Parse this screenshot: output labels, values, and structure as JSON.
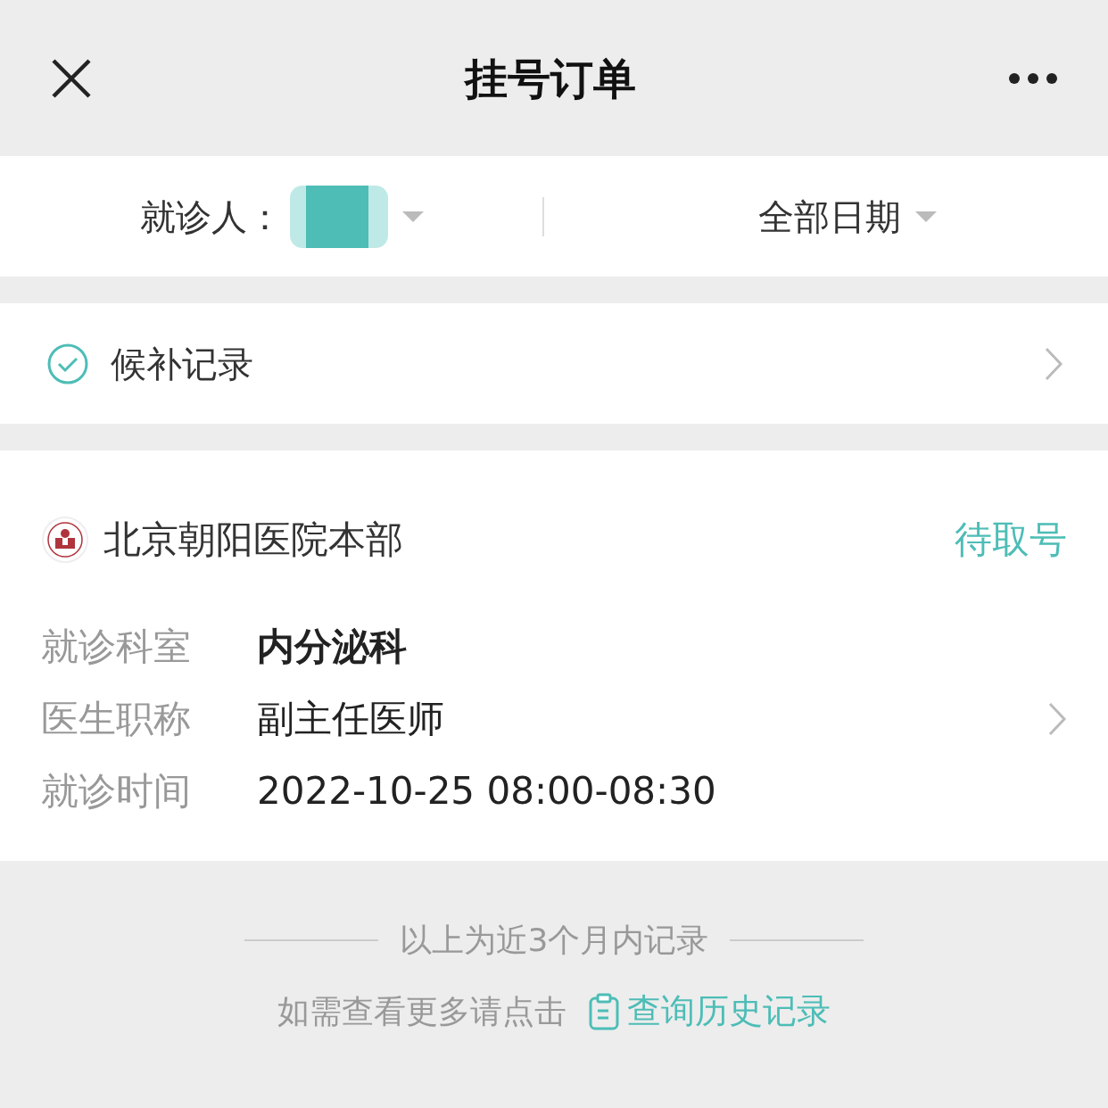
{
  "header": {
    "title": "挂号订单"
  },
  "filters": {
    "patient_label": "就诊人：",
    "date_label": "全部日期"
  },
  "waitlist": {
    "label": "候补记录"
  },
  "order": {
    "hospital": "北京朝阳医院本部",
    "status": "待取号",
    "details": [
      {
        "label": "就诊科室",
        "value": "内分泌科",
        "emphasis": true
      },
      {
        "label": "医生职称",
        "value": "副主任医师",
        "emphasis": false
      },
      {
        "label": "就诊时间",
        "value": "2022-10-25 08:00-08:30",
        "emphasis": false
      }
    ]
  },
  "footer": {
    "note": "以上为近3个月内记录",
    "prompt": "如需查看更多请点击",
    "link": "查询历史记录"
  }
}
